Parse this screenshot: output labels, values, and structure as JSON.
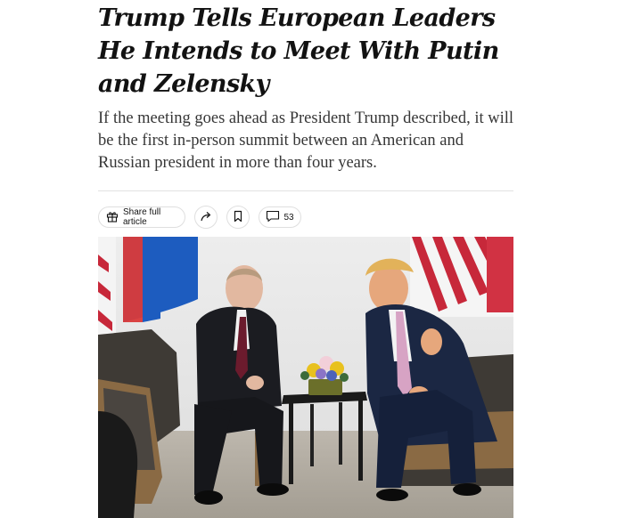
{
  "article": {
    "headline": "Trump Tells European Leaders He Intends to Meet With Putin and Zelensky",
    "dek": "If the meeting goes ahead as President Trump described, it will be the first in-person summit between an American and Russian president in more than four years."
  },
  "toolbar": {
    "share_label": "Share full article",
    "comment_count": "53"
  },
  "icons": {
    "share": "gift-icon",
    "forward": "share-arrow-icon",
    "save": "bookmark-icon",
    "comments": "comment-bubble-icon"
  },
  "colors": {
    "text": "#121212",
    "dek": "#363636",
    "divider": "#e2e2e2",
    "pill_border": "#dfdfdf"
  }
}
